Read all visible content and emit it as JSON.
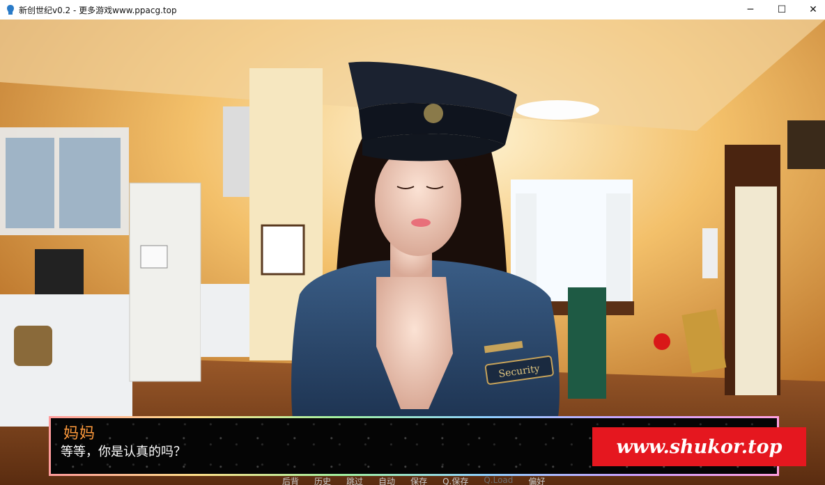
{
  "window": {
    "title": "新创世纪v0.2 - 更多游戏www.ppacg.top",
    "controls": [
      "─",
      "☐",
      "✕"
    ]
  },
  "dialogue": {
    "speaker": "妈妈",
    "text": "等等，你是认真的吗？"
  },
  "watermark": "www.shukor.top",
  "quick_menu": [
    "后背",
    "历史",
    "跳过",
    "自动",
    "保存",
    "Q.保存",
    "Q.Load",
    "偏好"
  ],
  "character_badge": "Security",
  "colors": {
    "speaker": "#ff9a3c",
    "watermark_bg": "#e5171f"
  }
}
